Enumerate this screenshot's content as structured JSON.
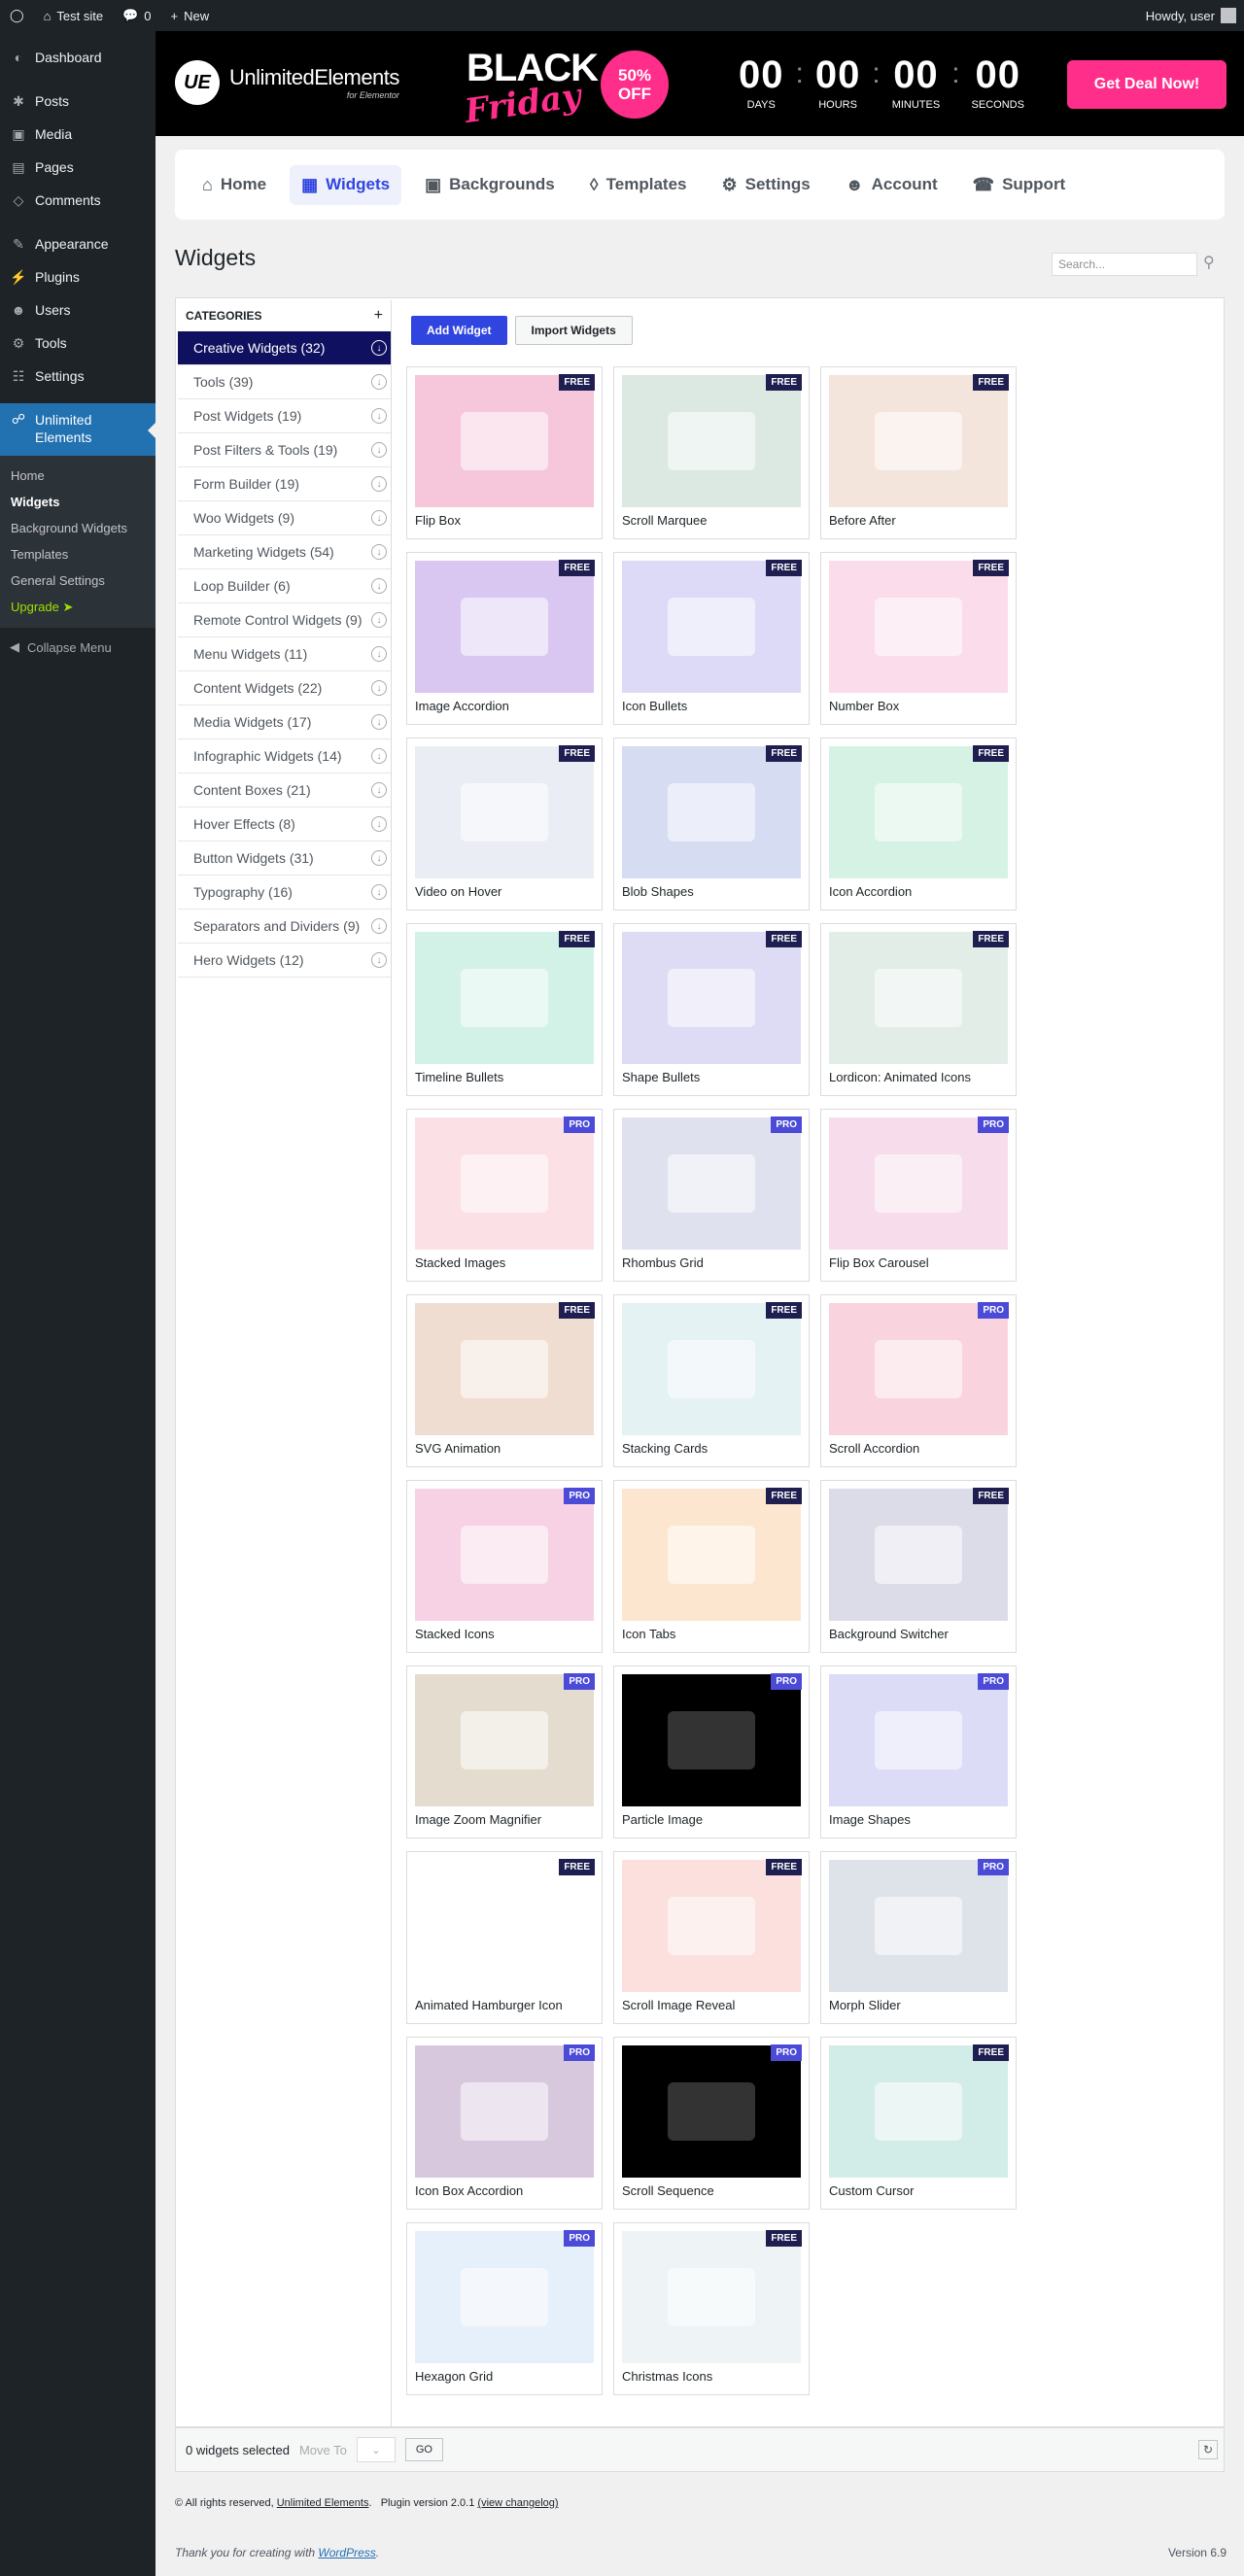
{
  "admin_bar": {
    "site": "Test site",
    "comments": "0",
    "new": "New",
    "howdy": "Howdy, user"
  },
  "sidebar": {
    "items": [
      {
        "label": "Dashboard",
        "icon": "dashboard-icon"
      },
      {
        "label": "Posts",
        "icon": "pin-icon"
      },
      {
        "label": "Media",
        "icon": "media-icon"
      },
      {
        "label": "Pages",
        "icon": "page-icon"
      },
      {
        "label": "Comments",
        "icon": "comment-icon"
      },
      {
        "label": "Appearance",
        "icon": "brush-icon"
      },
      {
        "label": "Plugins",
        "icon": "plug-icon"
      },
      {
        "label": "Users",
        "icon": "user-icon"
      },
      {
        "label": "Tools",
        "icon": "wrench-icon"
      },
      {
        "label": "Settings",
        "icon": "settings-icon"
      }
    ],
    "current": "Unlimited Elements",
    "submenu": [
      "Home",
      "Widgets",
      "Background Widgets",
      "Templates",
      "General Settings",
      "Upgrade ➤"
    ],
    "collapse": "Collapse Menu"
  },
  "banner": {
    "logo_text": "UnlimitedElements",
    "logo_sub": "for Elementor",
    "black": "BLACK",
    "friday": "Friday",
    "off_pct": "50%",
    "off_label": "OFF",
    "countdown": [
      {
        "num": "00",
        "label": "DAYS"
      },
      {
        "num": "00",
        "label": "HOURS"
      },
      {
        "num": "00",
        "label": "MINUTES"
      },
      {
        "num": "00",
        "label": "SECONDS"
      }
    ],
    "deal": "Get Deal Now!"
  },
  "nav": [
    "Home",
    "Widgets",
    "Backgrounds",
    "Templates",
    "Settings",
    "Account",
    "Support"
  ],
  "page_title": "Widgets",
  "search_placeholder": "Search...",
  "categories_title": "CATEGORIES",
  "categories": [
    "Creative Widgets (32)",
    "Tools (39)",
    "Post Widgets (19)",
    "Post Filters & Tools (19)",
    "Form Builder (19)",
    "Woo Widgets (9)",
    "Marketing Widgets (54)",
    "Loop Builder (6)",
    "Remote Control Widgets (9)",
    "Menu Widgets (11)",
    "Content Widgets (22)",
    "Media Widgets (17)",
    "Infographic Widgets (14)",
    "Content Boxes (21)",
    "Hover Effects (8)",
    "Button Widgets (31)",
    "Typography (16)",
    "Separators and Dividers (9)",
    "Hero Widgets (12)"
  ],
  "buttons": {
    "add": "Add Widget",
    "import": "Import Widgets"
  },
  "widgets": [
    {
      "name": "Flip Box",
      "badge": "FREE",
      "color": "#f6c6da"
    },
    {
      "name": "Scroll Marquee",
      "badge": "FREE",
      "color": "#dce8e2"
    },
    {
      "name": "Before After",
      "badge": "FREE",
      "color": "#f3e4dc"
    },
    {
      "name": "Image Accordion",
      "badge": "FREE",
      "color": "#d9c7f2"
    },
    {
      "name": "Icon Bullets",
      "badge": "FREE",
      "color": "#dcdaf6"
    },
    {
      "name": "Number Box",
      "badge": "FREE",
      "color": "#fbdcea"
    },
    {
      "name": "Video on Hover",
      "badge": "FREE",
      "color": "#eaeef4"
    },
    {
      "name": "Blob Shapes",
      "badge": "FREE",
      "color": "#d6dcf2"
    },
    {
      "name": "Icon Accordion",
      "badge": "FREE",
      "color": "#d6f2e4"
    },
    {
      "name": "Timeline Bullets",
      "badge": "FREE",
      "color": "#d2f2e8"
    },
    {
      "name": "Shape Bullets",
      "badge": "FREE",
      "color": "#dedcf4"
    },
    {
      "name": "Lordicon: Animated Icons",
      "badge": "FREE",
      "color": "#e2ede8"
    },
    {
      "name": "Stacked Images",
      "badge": "PRO",
      "color": "#fbe1e6"
    },
    {
      "name": "Rhombus Grid",
      "badge": "PRO",
      "color": "#dfe1ef"
    },
    {
      "name": "Flip Box Carousel",
      "badge": "PRO",
      "color": "#f7dcec"
    },
    {
      "name": "SVG Animation",
      "badge": "FREE",
      "color": "#f0ddd2"
    },
    {
      "name": "Stacking Cards",
      "badge": "FREE",
      "color": "#e4f2f4"
    },
    {
      "name": "Scroll Accordion",
      "badge": "PRO",
      "color": "#f9d4de"
    },
    {
      "name": "Stacked Icons",
      "badge": "PRO",
      "color": "#f6d2e4"
    },
    {
      "name": "Icon Tabs",
      "badge": "FREE",
      "color": "#fde6d0"
    },
    {
      "name": "Background Switcher",
      "badge": "FREE",
      "color": "#dcdce8"
    },
    {
      "name": "Image Zoom Magnifier",
      "badge": "PRO",
      "color": "#e4dccf"
    },
    {
      "name": "Particle Image",
      "badge": "PRO",
      "color": "#000000"
    },
    {
      "name": "Image Shapes",
      "badge": "PRO",
      "color": "#dcdcf6"
    },
    {
      "name": "Animated Hamburger Icon",
      "badge": "FREE",
      "color": "#ffffff"
    },
    {
      "name": "Scroll Image Reveal",
      "badge": "FREE",
      "color": "#fbe0de"
    },
    {
      "name": "Morph Slider",
      "badge": "PRO",
      "color": "#dee3ea"
    },
    {
      "name": "Icon Box Accordion",
      "badge": "PRO",
      "color": "#d8c8de"
    },
    {
      "name": "Scroll Sequence",
      "badge": "PRO",
      "color": "#000000"
    },
    {
      "name": "Custom Cursor",
      "badge": "FREE",
      "color": "#d2ece8"
    },
    {
      "name": "Hexagon Grid",
      "badge": "PRO",
      "color": "#e6f0fa"
    },
    {
      "name": "Christmas Icons",
      "badge": "FREE",
      "color": "#eef4f6"
    }
  ],
  "bottom": {
    "selected": "0 widgets selected",
    "move_to": "Move To",
    "go": "GO"
  },
  "footer": {
    "copy": "© All rights reserved,",
    "copy_link": "Unlimited Elements",
    "plugin_version": "Plugin version 2.0.1",
    "changelog": "(view changelog)",
    "thanks": "Thank you for creating with",
    "wp": "WordPress",
    "version": "Version 6.9"
  }
}
